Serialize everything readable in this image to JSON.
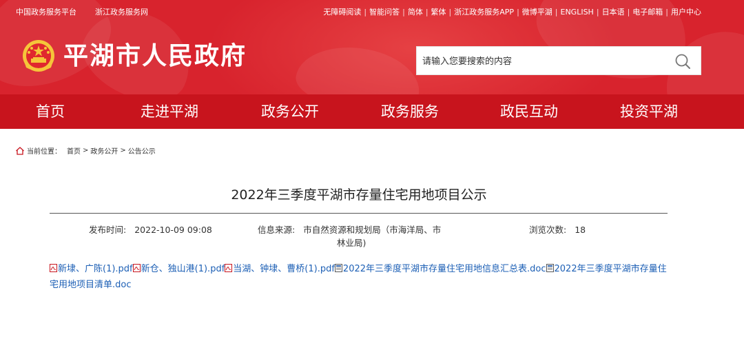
{
  "topbar": {
    "left_links": [
      "中国政务服务平台",
      "浙江政务服务网"
    ],
    "right_links": [
      "无障碍阅读",
      "智能问答",
      "简体",
      "繁体",
      "浙江政务服务APP",
      "微博平湖",
      "ENGLISH",
      "日本语",
      "电子邮箱",
      "用户中心"
    ]
  },
  "site": {
    "title": "平湖市人民政府"
  },
  "search": {
    "placeholder": "请输入您要搜索的内容"
  },
  "nav": {
    "items": [
      "首页",
      "走进平湖",
      "政务公开",
      "政务服务",
      "政民互动",
      "投资平湖"
    ]
  },
  "breadcrumb": {
    "label": "当前位置：",
    "items": [
      "首页",
      "政务公开",
      "公告公示"
    ],
    "separator": ">"
  },
  "article": {
    "title": "2022年三季度平湖市存量住宅用地项目公示",
    "publish_label": "发布时间:",
    "publish_value": "2022-10-09 09:08",
    "source_label": "信息来源:",
    "source_value_line1": "市自然资源和规划局（市海洋局、市",
    "source_value_line2": "林业局)",
    "views_label": "浏览次数:",
    "views_value": "18"
  },
  "attachments": [
    {
      "name": "新埭、广陈(1).pdf",
      "type": "pdf"
    },
    {
      "name": "新仓、独山港(1).pdf",
      "type": "pdf"
    },
    {
      "name": "当湖、钟埭、曹桥(1).pdf",
      "type": "pdf"
    },
    {
      "name": "2022年三季度平湖市存量住宅用地信息汇总表.doc",
      "type": "doc"
    },
    {
      "name": "2022年三季度平湖市存量住宅用地项目清单.doc",
      "type": "doc"
    }
  ],
  "colors": {
    "header_red": "#d8232d",
    "nav_red": "#c8141d",
    "link_blue": "#1c5fb5"
  },
  "icons": [
    "national-emblem-icon",
    "search-icon",
    "home-icon",
    "pdf-file-icon",
    "doc-file-icon"
  ]
}
